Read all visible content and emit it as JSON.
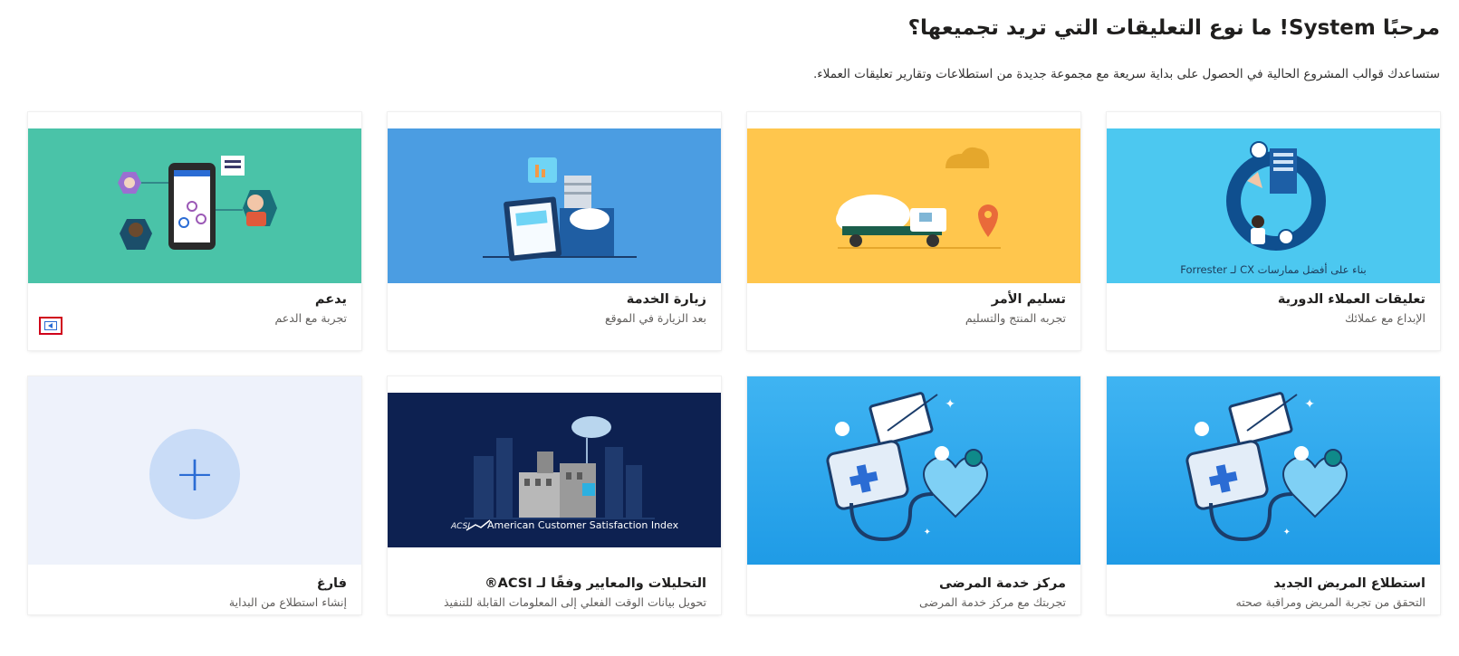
{
  "header": {
    "title": "مرحبًا System! ما نوع التعليقات التي تريد تجميعها؟",
    "subtitle": "ستساعدك قوالب المشروع الحالية في الحصول على بداية سريعة مع مجموعة جديدة من استطلاعات وتقارير تعليقات العملاء."
  },
  "templates": [
    {
      "title": "تعليقات العملاء الدورية",
      "description": "الإبداع مع عملائك",
      "caption": "بناء على أفضل ممارسات CX لـ Forrester",
      "illustration": "customer-loop-illustration",
      "color": "#4cc8f0"
    },
    {
      "title": "تسليم الأمر",
      "description": "تجربه المنتج والتسليم",
      "illustration": "delivery-truck-illustration",
      "color": "#ffc64d"
    },
    {
      "title": "زيارة الخدمة",
      "description": "بعد الزيارة في الموقع",
      "illustration": "service-visit-illustration",
      "color": "#4b9de2"
    },
    {
      "title": "يدعم",
      "description": "تجربة مع الدعم",
      "illustration": "support-illustration",
      "color": "#4ac3a8",
      "feedback_icon": "feedback-icon"
    },
    {
      "title": "استطلاع المريض الجديد",
      "description": "التحقق من تجربة المريض ومراقبة صحته",
      "illustration": "medical-kit-illustration",
      "color": "#2ba7ec"
    },
    {
      "title": "مركز خدمة المرضى",
      "description": "تجربتك مع مركز خدمة المرضى",
      "illustration": "medical-kit-illustration",
      "color": "#2ba7ec"
    },
    {
      "title": "التحليلات والمعايير وفقًا لـ ACSI®",
      "description": "تحويل بيانات الوقت الفعلي إلى المعلومات القابلة للتنفيذ",
      "caption": "American Customer Satisfaction Index",
      "logo": "ACSI",
      "illustration": "city-cloud-illustration",
      "color": "#0d2151"
    },
    {
      "title": "فارغ",
      "description": "إنشاء استطلاع من البداية",
      "icon": "plus-icon",
      "color": "#eef2fb"
    }
  ]
}
